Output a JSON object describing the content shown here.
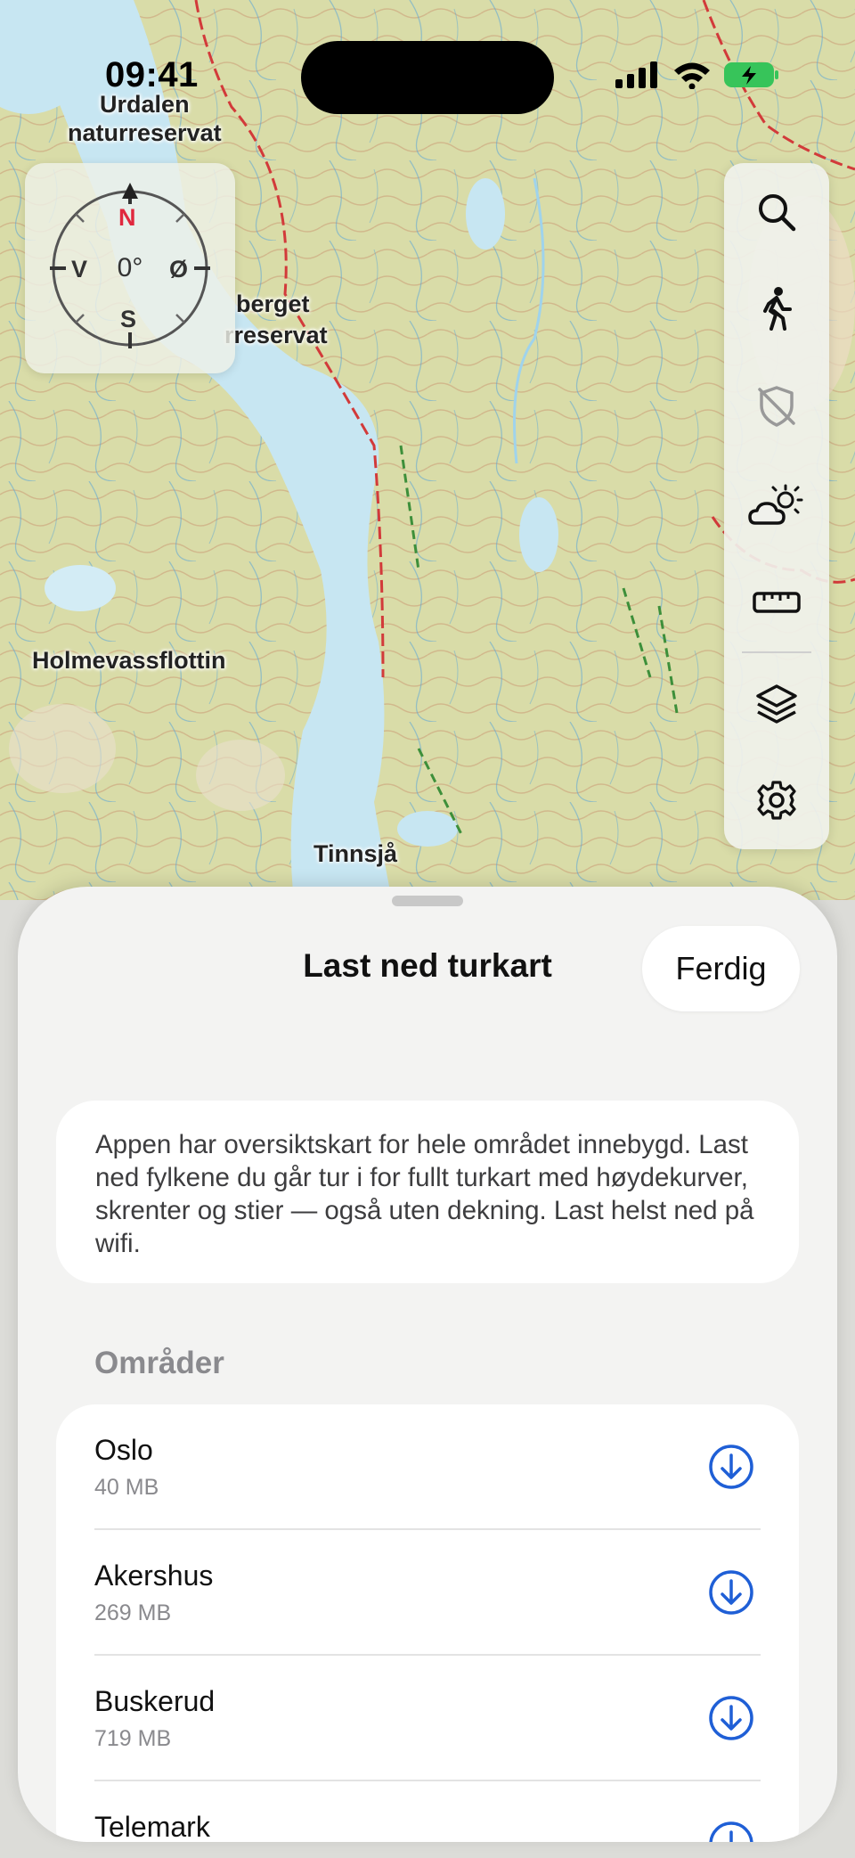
{
  "status_bar": {
    "time": "09:41"
  },
  "map": {
    "labels": {
      "urdalen": "Urdalen\nnaturreservat",
      "berget": "berget",
      "reservat": "rreservat",
      "holmevass": "Holmevassflottin",
      "tinnsja": "Tinnsjå"
    }
  },
  "compass": {
    "north": "N",
    "south": "S",
    "west": "V",
    "east": "Ø",
    "heading": "0°"
  },
  "toolbar": {
    "icons": [
      "search-icon",
      "hiking-icon",
      "shield-off-icon",
      "weather-icon",
      "ruler-icon",
      "layers-icon",
      "settings-icon"
    ]
  },
  "sheet": {
    "title": "Last ned turkart",
    "done_label": "Ferdig",
    "info": "Appen har oversiktskart for hele området innebygd. Last ned fylkene du går tur i for fullt turkart med høydekurver, skrenter og stier — også uten dekning. Last helst ned på wifi.",
    "section_header": "Områder",
    "regions": [
      {
        "name": "Oslo",
        "size": "40 MB"
      },
      {
        "name": "Akershus",
        "size": "269 MB"
      },
      {
        "name": "Buskerud",
        "size": "719 MB"
      },
      {
        "name": "Telemark",
        "size": ""
      }
    ]
  },
  "colors": {
    "accent": "#1f5fd6",
    "compass_north": "#e0283e",
    "map_water": "#c7e6f2",
    "map_land": "#d9dca8"
  }
}
